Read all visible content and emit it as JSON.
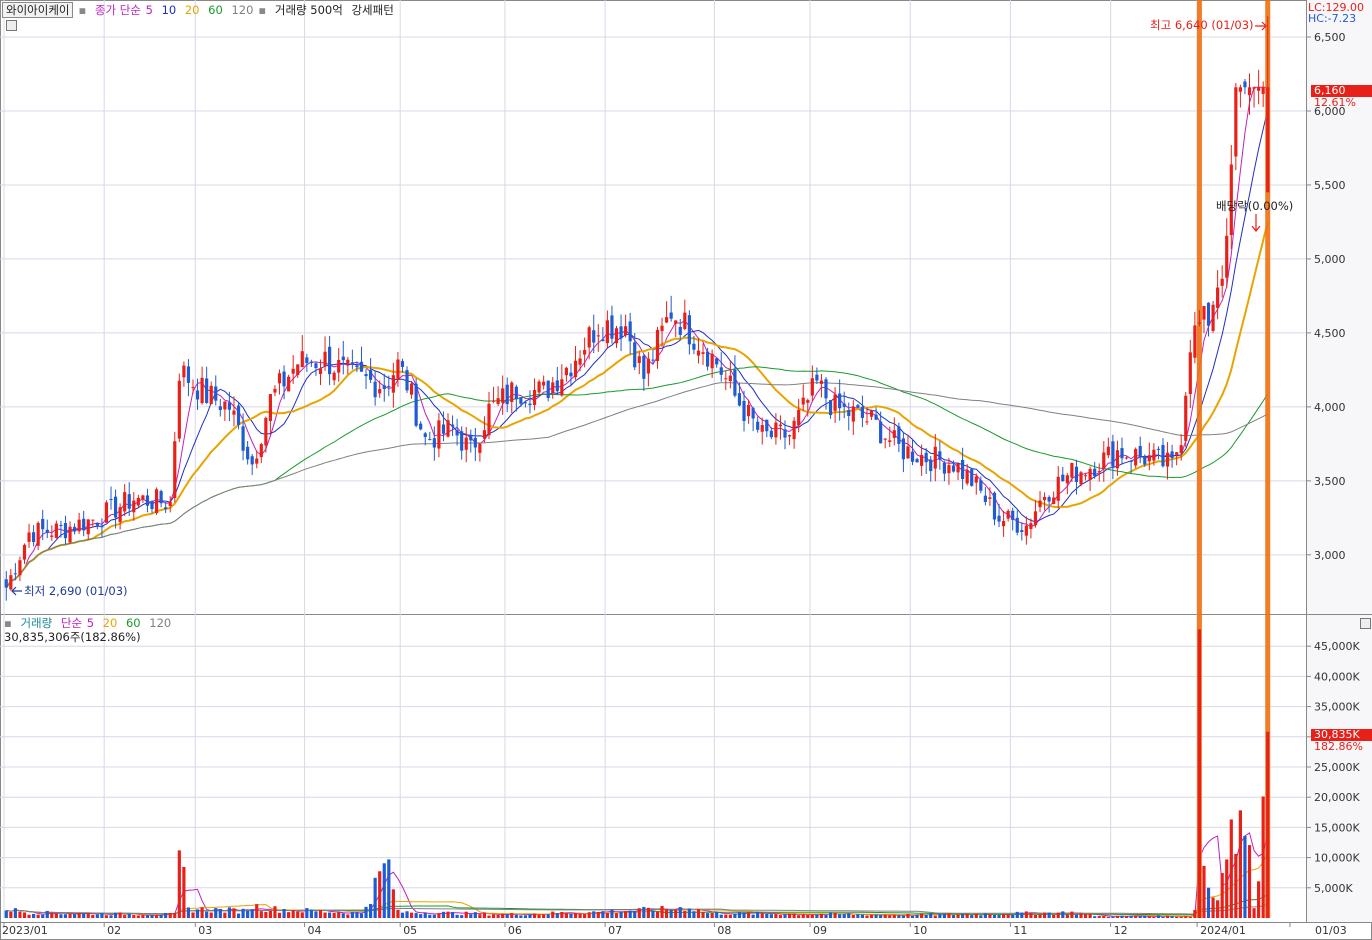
{
  "price_legend": {
    "stock_name": "와이아이케이",
    "ma_label": "종가 단순",
    "ma_periods": [
      "5",
      "10",
      "20",
      "60",
      "120"
    ],
    "extra_items": [
      "거래량 500억",
      "강세패턴"
    ]
  },
  "volume_legend": {
    "title": "거래량",
    "ma_label": "단순",
    "ma_periods": [
      "5",
      "20",
      "60",
      "120"
    ],
    "current": "30,835,306주(182.86%)"
  },
  "corner_info": {
    "lc": "LC:129.00",
    "hc": "HC:-7.23"
  },
  "annotations": {
    "high": "최고 6,640 (01/03)",
    "low": "최저 2,690 (01/03)",
    "dividend": "배당락(0.00%)"
  },
  "price_tag": {
    "value": "6,160",
    "change": "12.61%"
  },
  "volume_tag": {
    "value": "30,835K",
    "change": "182.86%"
  },
  "colors": {
    "up": "#e8201a",
    "down": "#1f5bd1",
    "ma5": "#c020c0",
    "ma10": "#2030c0",
    "ma20": "#e8a400",
    "ma60": "#1a9a2a",
    "ma120": "#808080",
    "highlight": "#f07010"
  },
  "chart_data": [
    {
      "type": "candlestick",
      "y_ticks": [
        "3,000",
        "3,500",
        "4,000",
        "4,500",
        "5,000",
        "5,500",
        "6,000",
        "6,500"
      ],
      "x_ticks": [
        "2023/01",
        "02",
        "03",
        "04",
        "05",
        "06",
        "07",
        "08",
        "09",
        "10",
        "11",
        "12",
        "2024/01",
        "01/03"
      ],
      "ylim": [
        2600,
        6750
      ],
      "grid": true,
      "last_close": 6160,
      "change_pct": 12.61,
      "period_high": 6640,
      "period_low": 2690,
      "series": [
        {
          "name": "5",
          "type": "line"
        },
        {
          "name": "10",
          "type": "line"
        },
        {
          "name": "20",
          "type": "line"
        },
        {
          "name": "60",
          "type": "line"
        },
        {
          "name": "120",
          "type": "line"
        }
      ],
      "control_points": {
        "close": [
          [
            0,
            2780
          ],
          [
            5,
            3150
          ],
          [
            12,
            3170
          ],
          [
            20,
            3250
          ],
          [
            28,
            3380
          ],
          [
            36,
            3350
          ],
          [
            38,
            4250
          ],
          [
            44,
            4080
          ],
          [
            49,
            4000
          ],
          [
            54,
            3620
          ],
          [
            58,
            4050
          ],
          [
            64,
            4300
          ],
          [
            70,
            4320
          ],
          [
            76,
            4200
          ],
          [
            83,
            4150
          ],
          [
            86,
            4280
          ],
          [
            88,
            4160
          ],
          [
            92,
            3780
          ],
          [
            98,
            3850
          ],
          [
            102,
            3700
          ],
          [
            106,
            3980
          ],
          [
            112,
            4120
          ],
          [
            118,
            4100
          ],
          [
            124,
            4300
          ],
          [
            130,
            4560
          ],
          [
            136,
            4550
          ],
          [
            140,
            4200
          ],
          [
            146,
            4650
          ],
          [
            152,
            4450
          ],
          [
            156,
            4300
          ],
          [
            160,
            4070
          ],
          [
            166,
            3800
          ],
          [
            172,
            3810
          ],
          [
            178,
            4150
          ],
          [
            182,
            3990
          ],
          [
            186,
            3950
          ],
          [
            190,
            3900
          ],
          [
            196,
            3720
          ],
          [
            202,
            3660
          ],
          [
            208,
            3620
          ],
          [
            212,
            3500
          ],
          [
            218,
            3250
          ],
          [
            224,
            3200
          ],
          [
            228,
            3420
          ],
          [
            234,
            3550
          ],
          [
            238,
            3600
          ],
          [
            244,
            3700
          ],
          [
            250,
            3660
          ],
          [
            256,
            3600
          ],
          [
            258,
            3820
          ],
          [
            260,
            4450
          ],
          [
            262,
            4550
          ],
          [
            264,
            4600
          ],
          [
            266,
            4850
          ],
          [
            268,
            5050
          ],
          [
            270,
            6160
          ]
        ],
        "volume_k": [
          [
            0,
            1500
          ],
          [
            5,
            900
          ],
          [
            20,
            700
          ],
          [
            37,
            600
          ],
          [
            38,
            11200
          ],
          [
            40,
            1500
          ],
          [
            52,
            1200
          ],
          [
            54,
            2000
          ],
          [
            58,
            1500
          ],
          [
            78,
            800
          ],
          [
            84,
            9700
          ],
          [
            86,
            1000
          ],
          [
            110,
            600
          ],
          [
            130,
            1000
          ],
          [
            136,
            1200
          ],
          [
            146,
            1500
          ],
          [
            150,
            1800
          ],
          [
            154,
            800
          ],
          [
            200,
            500
          ],
          [
            234,
            900
          ],
          [
            240,
            300
          ],
          [
            260,
            300
          ],
          [
            261,
            1200
          ],
          [
            262,
            47800
          ],
          [
            263,
            9000
          ],
          [
            264,
            5000
          ],
          [
            266,
            3000
          ],
          [
            268,
            16000
          ],
          [
            270,
            13500
          ],
          [
            272,
            15500
          ],
          [
            274,
            2500
          ],
          [
            276,
            17000
          ],
          [
            277,
            30835
          ]
        ]
      },
      "y2_ticks": [
        "5,000K",
        "10,000K",
        "15,000K",
        "20,000K",
        "25,000K",
        "30,000K",
        "35,000K",
        "40,000K",
        "45,000K"
      ],
      "y2lim": [
        0,
        50000
      ]
    }
  ]
}
